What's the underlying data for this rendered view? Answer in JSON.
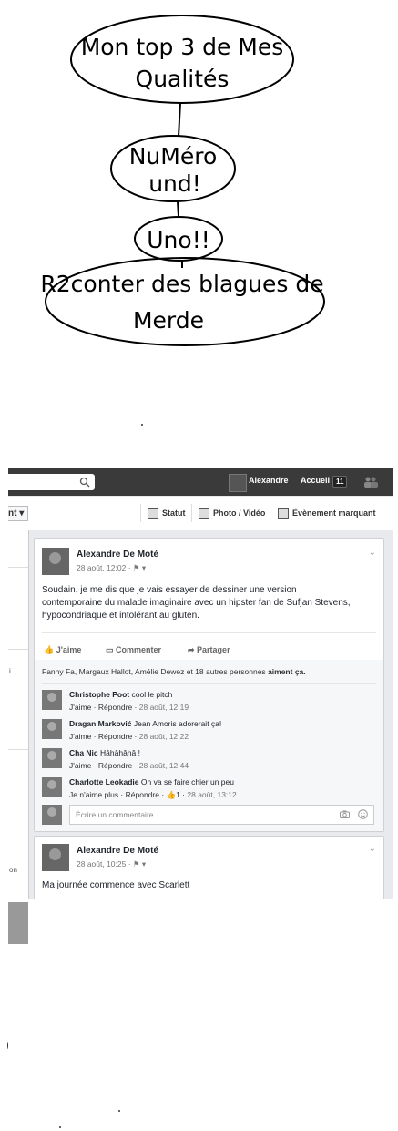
{
  "drawing": {
    "node1": {
      "line1": "Mon top 3 de Mes",
      "line2": "Qualités"
    },
    "node2": {
      "line1": "NuMéro",
      "line2": "und!"
    },
    "node3": {
      "line1": "Uno!!"
    },
    "node4": {
      "line1": "R2conter des blagues de",
      "line2": "Merde"
    }
  },
  "facebook": {
    "topbar": {
      "user_name": "Alexandre",
      "home_label": "Accueil",
      "home_count": "11"
    },
    "composer": {
      "left_label": "nt ▾",
      "status_label": "Statut",
      "photo_label": "Photo / Vidéo",
      "event_label": "Évènement marquant"
    },
    "left_column": {
      "snippets": [
        "i",
        "on"
      ]
    },
    "post1": {
      "author": "Alexandre De Moté",
      "meta": "28 août, 12:02 · ⚑ ▾",
      "text_line1": "Soudain, je me dis que je vais essayer de dessiner une version",
      "text_line2": "contemporaine du malade imaginaire avec un hipster fan de Sufjan Stevens,",
      "text_line3": "hypocondriaque et intolérant au gluten.",
      "actions": {
        "like": "J'aime",
        "comment": "Commenter",
        "share": "Partager"
      },
      "likes": {
        "names": "Fanny Fa, Margaux Hallot, Amélie Dewez et 18 autres personnes",
        "suffix": "aiment ça."
      },
      "comments": [
        {
          "author": "Christophe Poot",
          "text": "cool le pitch",
          "meta_actions": "J'aime · Répondre ·",
          "time": "28 août, 12:19"
        },
        {
          "author": "Dragan Marković",
          "text": "Jean Amoris adorerait ça!",
          "meta_actions": "J'aime · Répondre ·",
          "time": "28 août, 12:22"
        },
        {
          "author": "Cha Nic",
          "text": "Hâhâhâhâ !",
          "meta_actions": "J'aime · Répondre ·",
          "time": "28 août, 12:44"
        },
        {
          "author": "Charlotte Leokadie",
          "text": "On va se faire chier un peu",
          "meta_actions": "Je n'aime plus · Répondre · 👍1 ·",
          "time": "28 août, 13:12"
        }
      ],
      "write_placeholder": "Écrire un commentaire..."
    },
    "post2": {
      "author": "Alexandre De Moté",
      "meta": "28 août, 10:25 · ⚑ ▾",
      "text": "Ma journée commence avec Scarlett"
    }
  }
}
